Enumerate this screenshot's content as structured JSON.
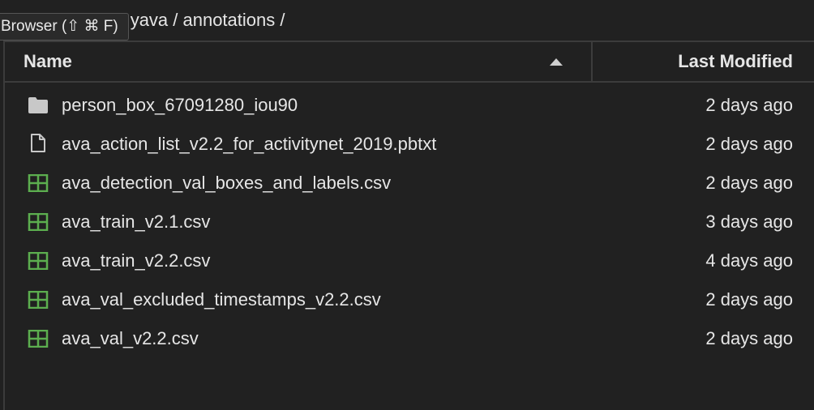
{
  "breadcrumb": {
    "hidden_prefix": "… / … /",
    "path": "yava / annotations /"
  },
  "tooltip": {
    "text": "Browser (⇧ ⌘ F)"
  },
  "table": {
    "columns": {
      "name": "Name",
      "modified": "Last Modified"
    },
    "sort": {
      "column": "Name",
      "direction": "ascending"
    },
    "rows": [
      {
        "icon": "folder-icon",
        "name": "person_box_67091280_iou90",
        "modified": "2 days ago"
      },
      {
        "icon": "file-icon",
        "name": "ava_action_list_v2.2_for_activitynet_2019.pbtxt",
        "modified": "2 days ago"
      },
      {
        "icon": "spreadsheet-icon",
        "name": "ava_detection_val_boxes_and_labels.csv",
        "modified": "2 days ago"
      },
      {
        "icon": "spreadsheet-icon",
        "name": "ava_train_v2.1.csv",
        "modified": "3 days ago"
      },
      {
        "icon": "spreadsheet-icon",
        "name": "ava_train_v2.2.csv",
        "modified": "4 days ago"
      },
      {
        "icon": "spreadsheet-icon",
        "name": "ava_val_excluded_timestamps_v2.2.csv",
        "modified": "2 days ago"
      },
      {
        "icon": "spreadsheet-icon",
        "name": "ava_val_v2.2.csv",
        "modified": "2 days ago"
      }
    ]
  },
  "colors": {
    "background": "#212121",
    "csv_icon": "#5cae4f",
    "folder_icon": "#c8c8c8"
  }
}
